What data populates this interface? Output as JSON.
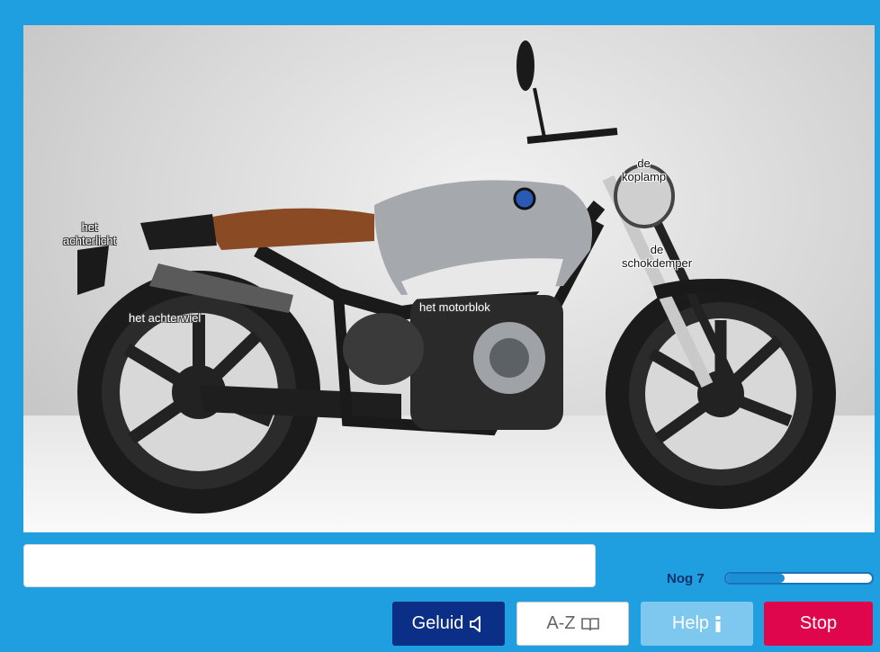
{
  "labels": {
    "koplamp": "de\nkoplamp",
    "achterlicht": "het\nachterlicht",
    "schokdemper": "de\nschokdemper",
    "achterwiel": "het achterwiel",
    "motorblok": "het motorblok"
  },
  "answer": {
    "value": "",
    "placeholder": ""
  },
  "status": {
    "remaining_label": "Nog 7",
    "progress": 0.4
  },
  "buttons": {
    "sound": "Geluid",
    "az": "A-Z",
    "help": "Help",
    "stop": "Stop"
  },
  "icons": {
    "sound": "speaker-icon",
    "az": "book-icon",
    "help": "info-icon"
  },
  "colors": {
    "background": "#1f9fe0",
    "sound_btn": "#0b2e86",
    "help_btn": "#7ec8f0",
    "stop_btn": "#e0064e"
  }
}
